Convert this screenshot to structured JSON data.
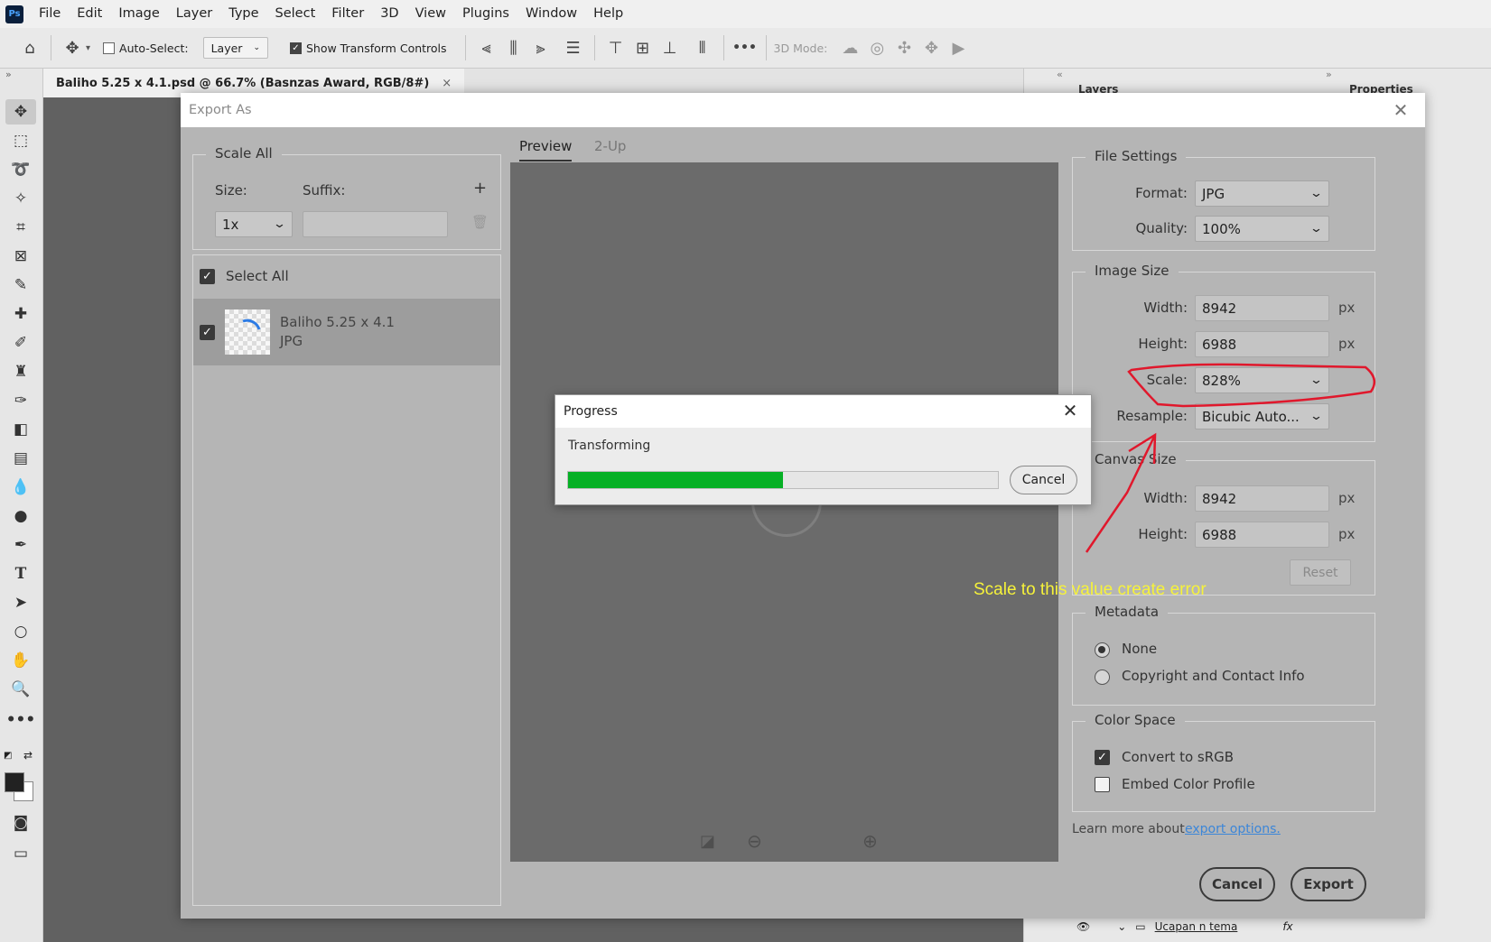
{
  "menubar": {
    "logo": "Ps",
    "items": [
      "File",
      "Edit",
      "Image",
      "Layer",
      "Type",
      "Select",
      "Filter",
      "3D",
      "View",
      "Plugins",
      "Window",
      "Help"
    ]
  },
  "options_bar": {
    "auto_select_label": "Auto-Select:",
    "auto_select_target": "Layer",
    "show_transform_label": "Show Transform Controls",
    "mode_3d_label": "3D Mode:",
    "more_label": "•••"
  },
  "document_tab": {
    "title": "Baliho 5.25 x 4.1.psd @ 66.7% (Basnzas Award, RGB/8#)",
    "close": "×"
  },
  "right_panel": {
    "collapse_left": "«",
    "collapse_right": "»",
    "tab_layers": "Layers",
    "tab_properties": "Properties",
    "layer_name": "Ucapan n tema",
    "fx": "fx"
  },
  "export_dialog": {
    "title": "Export As",
    "close": "✕",
    "scale_all": {
      "legend": "Scale All",
      "size_label": "Size:",
      "suffix_label": "Suffix:",
      "size_value": "1x",
      "suffix_value": "",
      "add": "+"
    },
    "assets": {
      "select_all_label": "Select All",
      "items": [
        {
          "name": "Baliho 5.25 x 4.1",
          "format": "JPG"
        }
      ]
    },
    "preview_tabs": [
      "Preview",
      "2-Up"
    ],
    "file_settings": {
      "legend": "File Settings",
      "format_label": "Format:",
      "format_value": "JPG",
      "quality_label": "Quality:",
      "quality_value": "100%"
    },
    "image_size": {
      "legend": "Image Size",
      "width_label": "Width:",
      "width_value": "8942",
      "height_label": "Height:",
      "height_value": "6988",
      "scale_label": "Scale:",
      "scale_value": "828%",
      "resample_label": "Resample:",
      "resample_value": "Bicubic Auto...",
      "unit": "px"
    },
    "canvas_size": {
      "legend": "Canvas Size",
      "width_label": "Width:",
      "width_value": "8942",
      "height_label": "Height:",
      "height_value": "6988",
      "unit": "px",
      "reset_label": "Reset"
    },
    "metadata": {
      "legend": "Metadata",
      "options": [
        "None",
        "Copyright and Contact Info"
      ],
      "selected": "None"
    },
    "color_space": {
      "legend": "Color Space",
      "convert_label": "Convert to sRGB",
      "convert_checked": true,
      "embed_label": "Embed Color Profile",
      "embed_checked": false
    },
    "learn_more_text": "Learn more about",
    "learn_more_link": "export options.",
    "cancel_label": "Cancel",
    "export_label": "Export"
  },
  "progress_dialog": {
    "title": "Progress",
    "close": "✕",
    "status": "Transforming",
    "progress": 0.5,
    "cancel_label": "Cancel"
  },
  "annotation": {
    "text": "Scale to this value create error",
    "color": "#f6f23a",
    "marker_color": "#e0182c"
  },
  "colors": {
    "progress_fill": "#06b025",
    "link": "#3c86d8"
  }
}
